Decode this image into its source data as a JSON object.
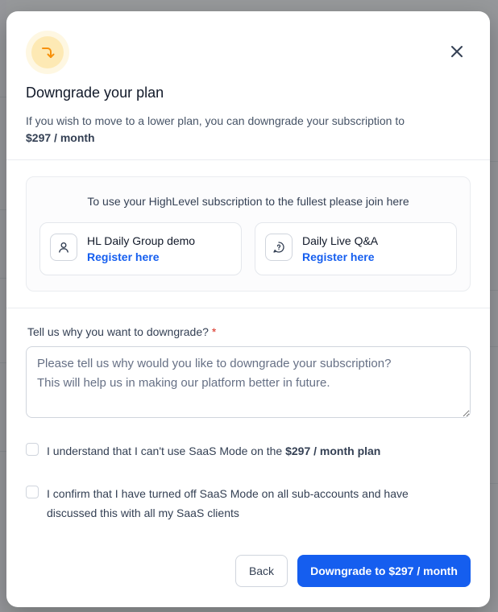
{
  "modal": {
    "title": "Downgrade your plan",
    "subtitle_prefix": "If you wish to move to a lower plan, you can downgrade your subscription to",
    "subtitle_price": "$297 / month"
  },
  "resources": {
    "heading": "To use your HighLevel subscription to the fullest please join here",
    "cards": [
      {
        "name": "HL Daily Group demo",
        "link_label": "Register here",
        "icon": "user-icon"
      },
      {
        "name": "Daily Live Q&A",
        "link_label": "Register here",
        "icon": "question-chat-icon"
      }
    ]
  },
  "reason": {
    "label": "Tell us why you want to downgrade?",
    "required_mark": "*",
    "placeholder": "Please tell us why would you like to downgrade your subscription?\nThis will help us in making our platform better in future.",
    "value": ""
  },
  "checkboxes": [
    {
      "text_prefix": "I understand that I can't use SaaS Mode on the ",
      "text_bold": "$297 / month plan",
      "checked": false
    },
    {
      "text_prefix": "I confirm that I have turned off SaaS Mode on all sub-accounts and have discussed this with all my SaaS clients",
      "text_bold": "",
      "checked": false
    }
  ],
  "actions": {
    "back_label": "Back",
    "confirm_label": "Downgrade to $297 / month"
  },
  "colors": {
    "primary": "#155eef",
    "icon_accent": "#f79009",
    "required": "#d92d20"
  }
}
